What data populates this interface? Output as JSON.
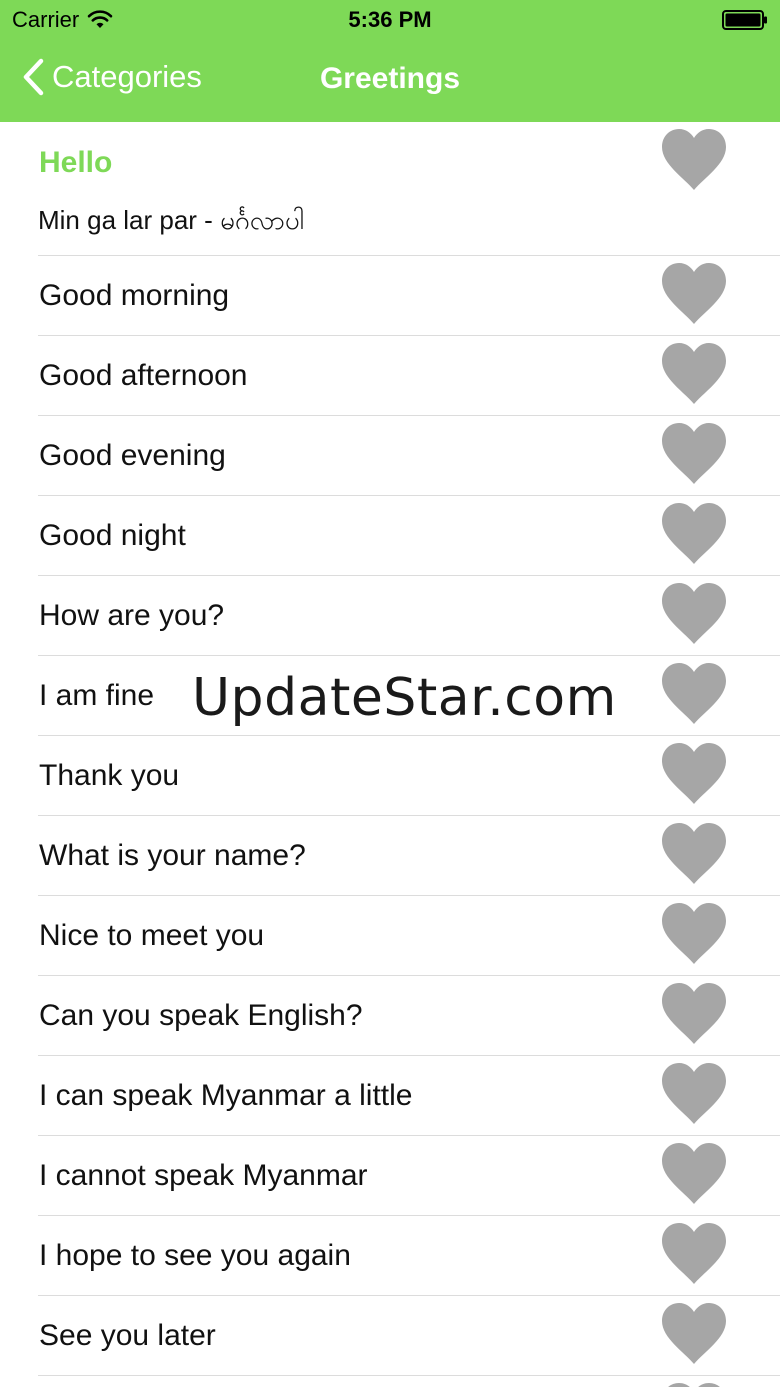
{
  "status_bar": {
    "carrier": "Carrier",
    "time": "5:36 PM"
  },
  "nav": {
    "back_label": "Categories",
    "title": "Greetings"
  },
  "first_item": {
    "title": "Hello",
    "translation": "Min ga lar par - မင်္ဂလာပါ"
  },
  "items": [
    "Good morning",
    "Good afternoon",
    "Good evening",
    "Good night",
    "How are you?",
    "I am fine",
    "Thank you",
    "What is your name?",
    "Nice to meet you",
    "Can you speak English?",
    "I can speak Myanmar a little",
    "I cannot speak Myanmar",
    "I hope to see you again",
    "See you later"
  ],
  "watermark": "UpdateStar.com",
  "colors": {
    "accent": "#7ed957",
    "heart": "#a6a6a6"
  },
  "icons": {
    "favorite": "heart-icon",
    "back": "chevron-left-icon"
  }
}
